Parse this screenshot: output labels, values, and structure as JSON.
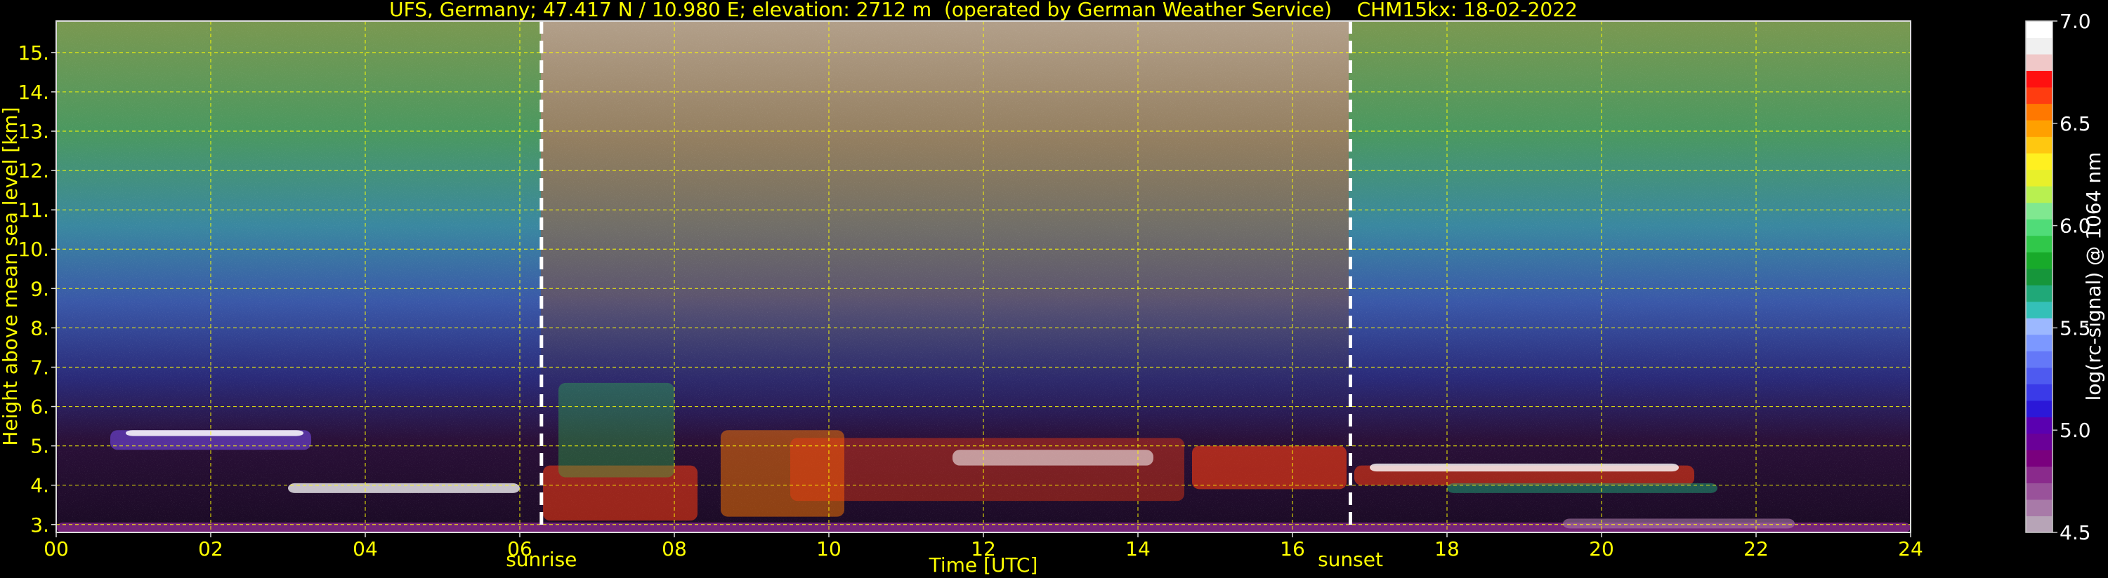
{
  "chart_data": {
    "type": "heatmap",
    "title": "UFS, Germany; 47.417 N / 10.980 E; elevation: 2712 m  (operated by German Weather Service)    CHM15kx: 18-02-2022",
    "xlabel": "Time [UTC]",
    "ylabel": "Height above mean sea level [km]",
    "colorbar_label": "log(rc-signal) @ 1064 nm",
    "xlim": [
      0,
      24
    ],
    "ylim": [
      2.8,
      15.8
    ],
    "x_ticks": [
      {
        "value": 0,
        "label": "00"
      },
      {
        "value": 2,
        "label": "02"
      },
      {
        "value": 4,
        "label": "04"
      },
      {
        "value": 6,
        "label": "06"
      },
      {
        "value": 8,
        "label": "08"
      },
      {
        "value": 10,
        "label": "10"
      },
      {
        "value": 12,
        "label": "12"
      },
      {
        "value": 14,
        "label": "14"
      },
      {
        "value": 16,
        "label": "16"
      },
      {
        "value": 18,
        "label": "18"
      },
      {
        "value": 20,
        "label": "20"
      },
      {
        "value": 22,
        "label": "22"
      },
      {
        "value": 24,
        "label": "24"
      }
    ],
    "y_ticks": [
      {
        "value": 3,
        "label": "3."
      },
      {
        "value": 4,
        "label": "4."
      },
      {
        "value": 5,
        "label": "5."
      },
      {
        "value": 6,
        "label": "6."
      },
      {
        "value": 7,
        "label": "7."
      },
      {
        "value": 8,
        "label": "8."
      },
      {
        "value": 9,
        "label": "9."
      },
      {
        "value": 10,
        "label": "10."
      },
      {
        "value": 11,
        "label": "11."
      },
      {
        "value": 12,
        "label": "12."
      },
      {
        "value": 13,
        "label": "13."
      },
      {
        "value": 14,
        "label": "14."
      },
      {
        "value": 15,
        "label": "15."
      }
    ],
    "grid": true,
    "colorbar": {
      "range": [
        4.5,
        7.0
      ],
      "ticks": [
        {
          "value": 7.0,
          "label": "7.0"
        },
        {
          "value": 6.5,
          "label": "6.5"
        },
        {
          "value": 6.0,
          "label": "6.0"
        },
        {
          "value": 5.5,
          "label": "5.5"
        },
        {
          "value": 5.0,
          "label": "5.0"
        },
        {
          "value": 4.5,
          "label": "4.5"
        }
      ],
      "colors_bottom_to_top": [
        "#b7a4b7",
        "#a87aa8",
        "#99529a",
        "#8a2a8c",
        "#7a007e",
        "#6a0098",
        "#5a00b0",
        "#2b18d8",
        "#3a3ae8",
        "#4e5af0",
        "#6478f8",
        "#7c98ff",
        "#9cb8ff",
        "#34c0b8",
        "#20a878",
        "#16963a",
        "#18aa2a",
        "#30c84a",
        "#50dc78",
        "#80e890",
        "#b8f050",
        "#e8f02a",
        "#fff020",
        "#ffc810",
        "#ffa000",
        "#ff7800",
        "#ff3c10",
        "#ff1010",
        "#f0c8c8",
        "#f0f0f0",
        "#ffffff"
      ]
    },
    "annotations": [
      {
        "label": "sunrise",
        "x": 6.28
      },
      {
        "label": "sunset",
        "x": 16.75
      }
    ],
    "text_color": "#ffff00",
    "grid_color": "#ffff00"
  }
}
